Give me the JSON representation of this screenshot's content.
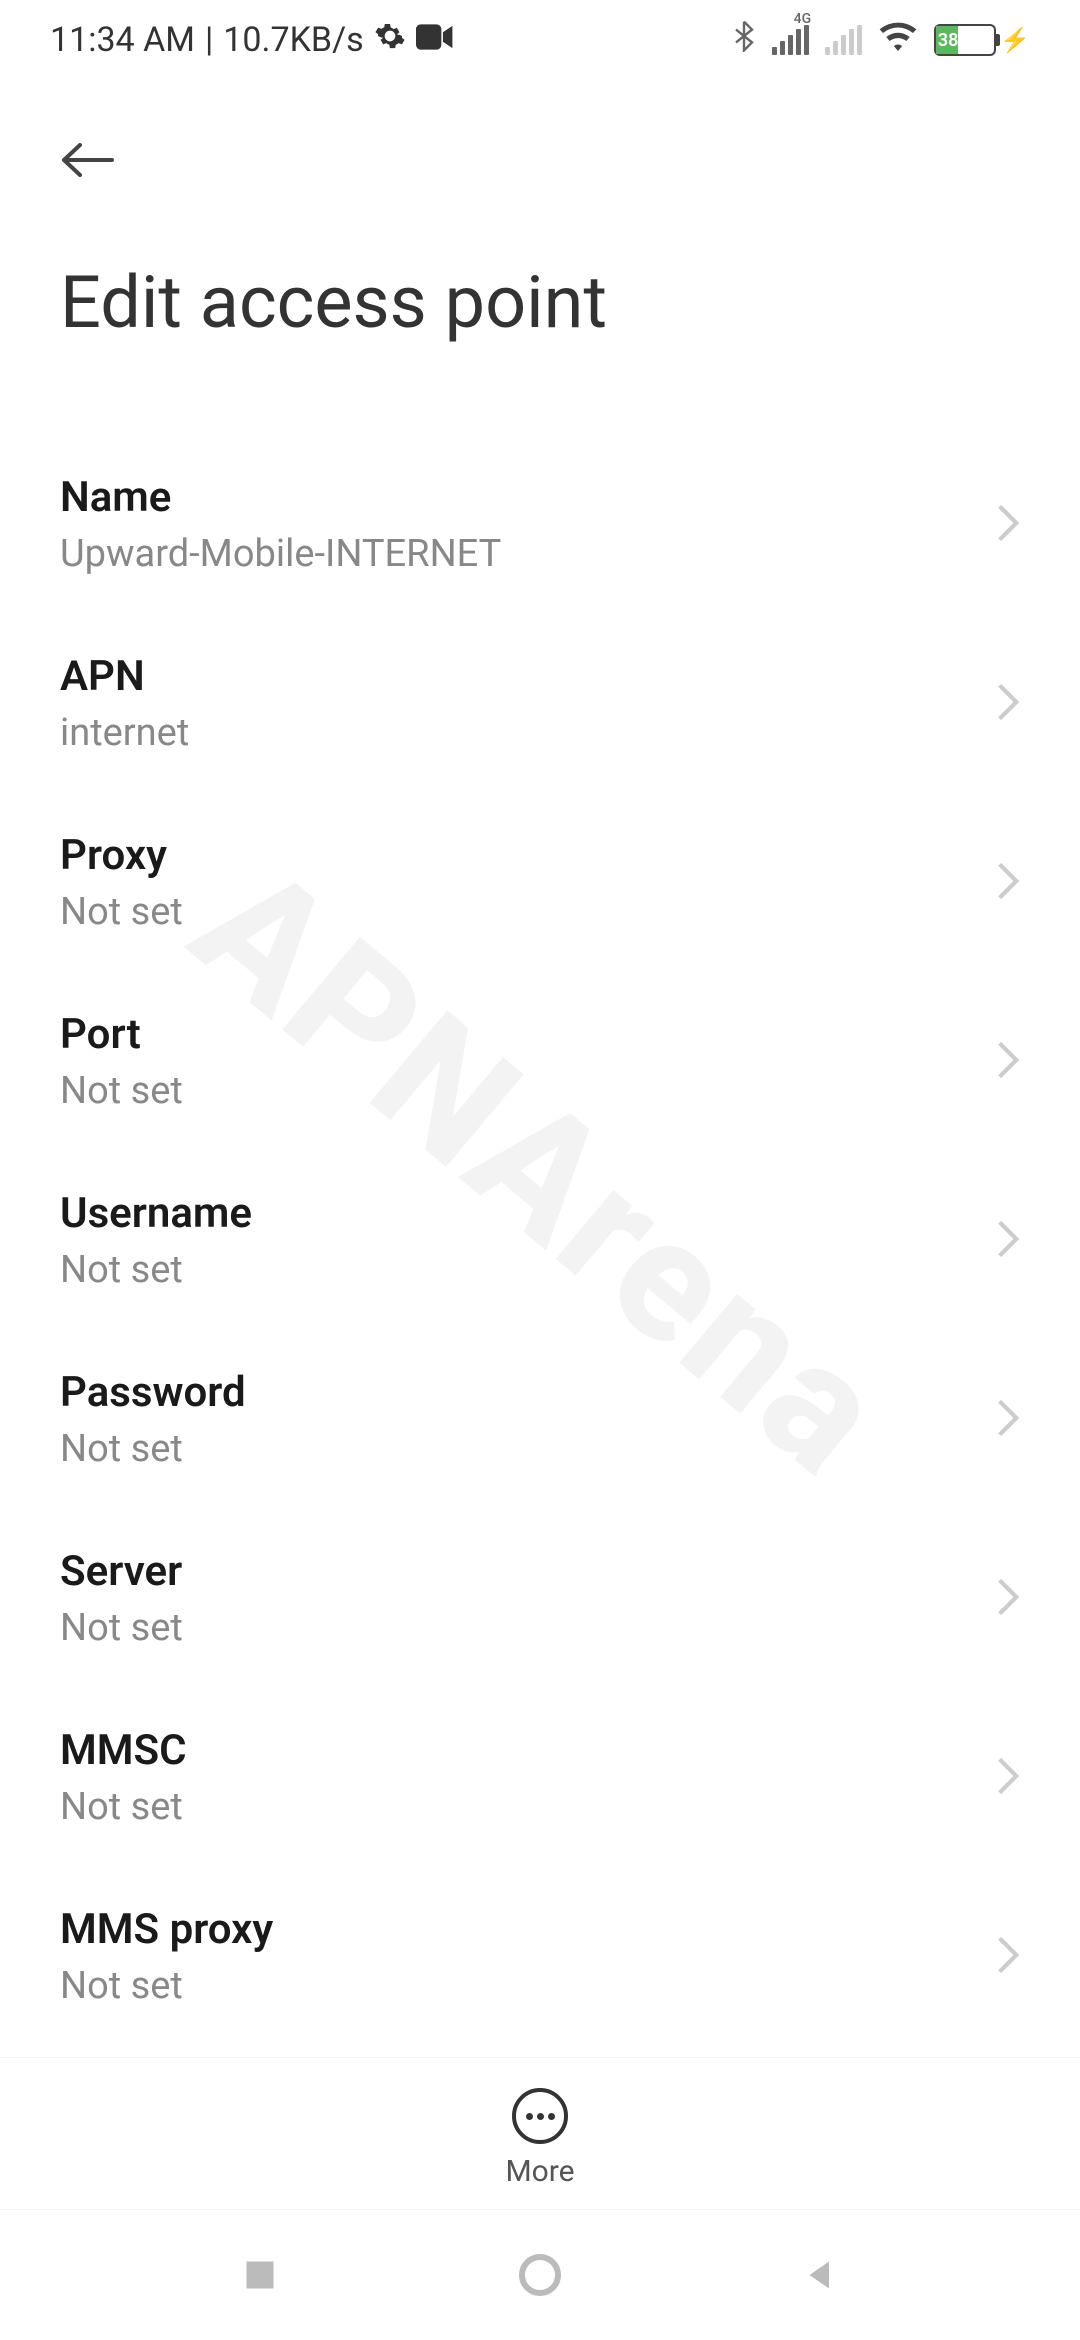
{
  "status": {
    "time": "11:34 AM",
    "net_speed": "10.7KB/s",
    "battery_pct": "38"
  },
  "header": {
    "title": "Edit access point"
  },
  "settings": [
    {
      "id": "name",
      "label": "Name",
      "value": "Upward-Mobile-INTERNET"
    },
    {
      "id": "apn",
      "label": "APN",
      "value": "internet"
    },
    {
      "id": "proxy",
      "label": "Proxy",
      "value": "Not set"
    },
    {
      "id": "port",
      "label": "Port",
      "value": "Not set"
    },
    {
      "id": "username",
      "label": "Username",
      "value": "Not set"
    },
    {
      "id": "password",
      "label": "Password",
      "value": "Not set"
    },
    {
      "id": "server",
      "label": "Server",
      "value": "Not set"
    },
    {
      "id": "mmsc",
      "label": "MMSC",
      "value": "Not set"
    },
    {
      "id": "mms_proxy",
      "label": "MMS proxy",
      "value": "Not set"
    }
  ],
  "bottom": {
    "more_label": "More"
  },
  "watermark": "APNArena"
}
